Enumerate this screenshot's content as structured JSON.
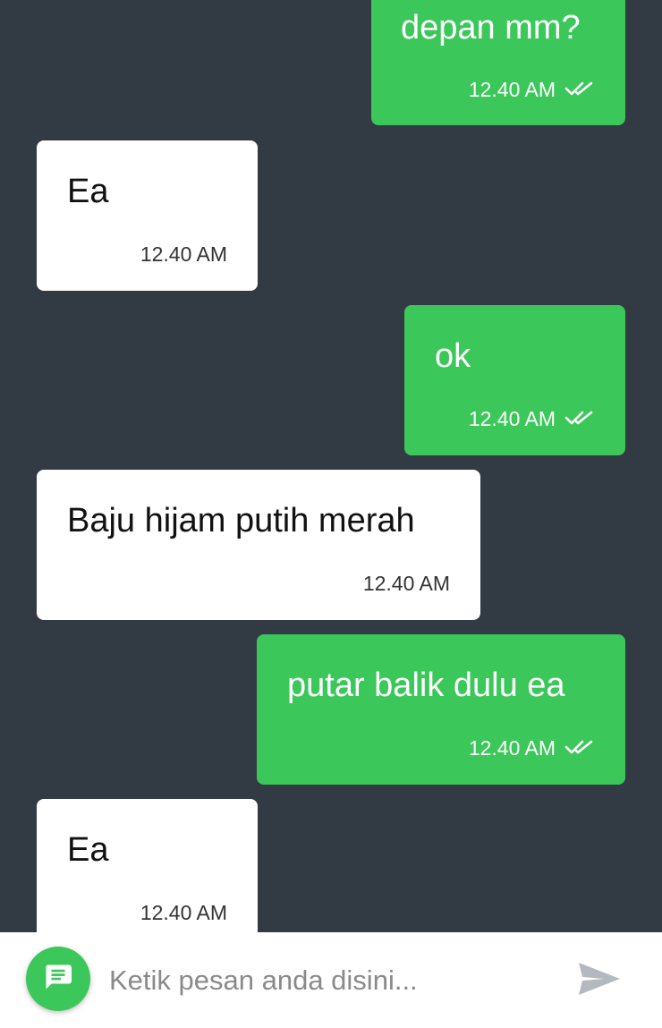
{
  "theme": {
    "background": "#323a44",
    "outgoing_bubble": "#3cc75a",
    "incoming_bubble": "#ffffff",
    "accent": "#3cc75a"
  },
  "messages": [
    {
      "direction": "outgoing",
      "text": "depan mm?",
      "time": "12.40 AM",
      "status": "read-double-check"
    },
    {
      "direction": "incoming",
      "text": "Ea",
      "time": "12.40 AM"
    },
    {
      "direction": "outgoing",
      "text": "ok",
      "time": "12.40 AM",
      "status": "read-double-check"
    },
    {
      "direction": "incoming",
      "text": "Baju hijam putih merah",
      "time": "12.40 AM"
    },
    {
      "direction": "outgoing",
      "text": "putar balik dulu ea",
      "time": "12.40 AM",
      "status": "read-double-check"
    },
    {
      "direction": "incoming",
      "text": "Ea",
      "time": "12.40 AM"
    }
  ],
  "composer": {
    "placeholder": "Ketik pesan anda disini...",
    "value": "",
    "left_icon": "chat-bubble-icon",
    "send_icon": "send-icon"
  }
}
